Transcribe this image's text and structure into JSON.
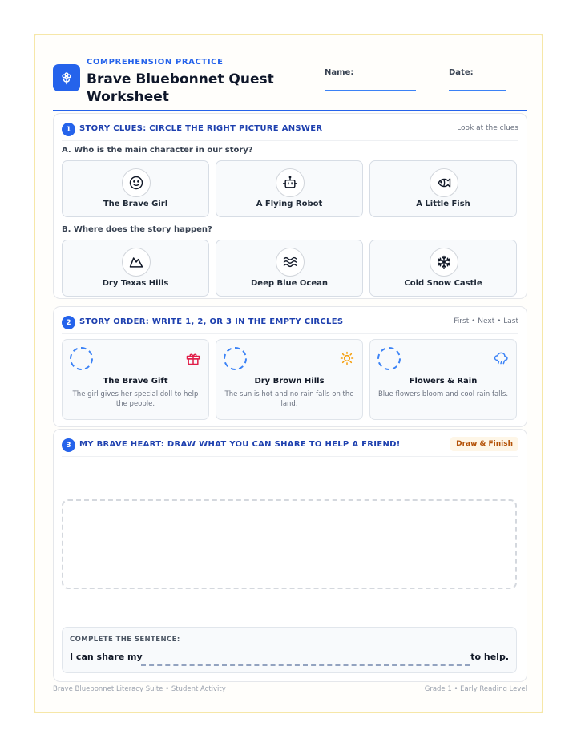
{
  "header": {
    "eyebrow": "COMPREHENSION PRACTICE",
    "title": "Brave Bluebonnet Quest Worksheet",
    "name_label": "Name:",
    "date_label": "Date:",
    "logo_icon": "flower-icon"
  },
  "section1": {
    "number": "1",
    "title": "STORY CLUES: CIRCLE THE RIGHT PICTURE ANSWER",
    "hint": "Look at the clues",
    "question_a": "A. Who is the main character in our story?",
    "choices_a": [
      {
        "label": "The Brave Girl",
        "icon": "smiley-face-icon"
      },
      {
        "label": "A Flying Robot",
        "icon": "robot-icon"
      },
      {
        "label": "A Little Fish",
        "icon": "fish-icon"
      }
    ],
    "question_b": "B. Where does the story happen?",
    "choices_b": [
      {
        "label": "Dry Texas Hills",
        "icon": "mountain-icon"
      },
      {
        "label": "Deep Blue Ocean",
        "icon": "waves-icon"
      },
      {
        "label": "Cold Snow Castle",
        "icon": "snowflake-icon"
      }
    ]
  },
  "section2": {
    "number": "2",
    "title": "STORY ORDER: WRITE 1, 2, OR 3 IN THE EMPTY CIRCLES",
    "hint": "First • Next • Last",
    "items": [
      {
        "title": "The Brave Gift",
        "desc": "The girl gives her special doll to help the people.",
        "icon": "gift-icon",
        "icon_color": "#e11d48"
      },
      {
        "title": "Dry Brown Hills",
        "desc": "The sun is hot and no rain falls on the land.",
        "icon": "sun-icon",
        "icon_color": "#f59e0b"
      },
      {
        "title": "Flowers & Rain",
        "desc": "Blue flowers bloom and cool rain falls.",
        "icon": "rain-cloud-icon",
        "icon_color": "#3b82f6"
      }
    ]
  },
  "section3": {
    "number": "3",
    "title": "MY BRAVE HEART: DRAW WHAT YOU CAN SHARE TO HELP A FRIEND!",
    "badge": "Draw & Finish",
    "sentence_label": "COMPLETE THE SENTENCE:",
    "sentence_start": "I can share my",
    "sentence_end": "to help."
  },
  "footer": {
    "left": "Brave Bluebonnet Literacy Suite • Student Activity",
    "right": "Grade 1 • Early Reading Level"
  },
  "colors": {
    "accent": "#2563eb",
    "heading": "#1e40af",
    "border_frame": "#f6e7a8"
  }
}
